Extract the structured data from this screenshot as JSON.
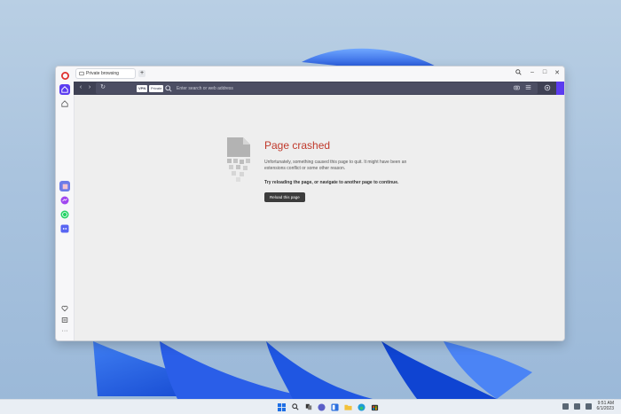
{
  "browser": {
    "tab": {
      "label": "Private browsing"
    },
    "address_bar": {
      "vpn_label": "VPN",
      "private_label": "Private",
      "placeholder": "Enter search or web address"
    }
  },
  "page": {
    "title": "Page crashed",
    "description": "Unfortunately, something caused this page to quit. It might have been an extensions conflict or some other reason.",
    "instruction": "Try reloading the page, or navigate to another page to continue.",
    "reload_button": "Reload this page"
  },
  "taskbar": {
    "clock": {
      "time": "9:51 AM",
      "date": "6/1/2023"
    }
  },
  "colors": {
    "accent": "#5b3cf0",
    "error": "#c0392b",
    "address_bar": "#3f4154"
  },
  "sidebar": {
    "items": [
      "opera-logo-icon",
      "home-icon",
      "speed-dial-icon",
      "gallery-icon",
      "messenger-icon",
      "whatsapp-icon",
      "discord-icon",
      "heart-icon",
      "history-icon",
      "more-icon"
    ]
  }
}
